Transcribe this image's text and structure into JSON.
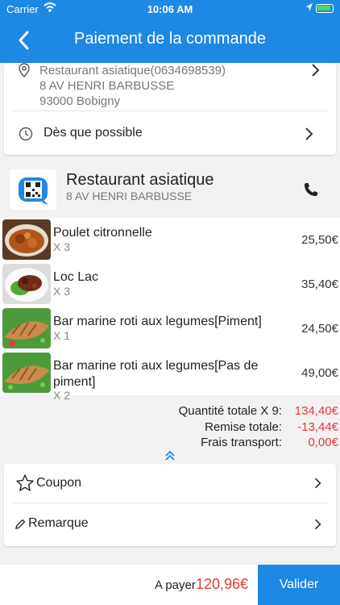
{
  "status_bar": {
    "carrier": "Carrier",
    "time": "10:06 AM"
  },
  "header": {
    "title": "Paiement de la commande"
  },
  "delivery": {
    "address_line1": "Restaurant asiatique(0634698539)",
    "address_line2": "8 AV HENRI BARBUSSE",
    "address_line3": "93000 Bobigny",
    "time_label": "Dès que possible"
  },
  "restaurant": {
    "name": "Restaurant asiatique",
    "address": "8 AV HENRI BARBUSSE"
  },
  "items": [
    {
      "name": "Poulet citronnelle",
      "qty": "X 3",
      "price": "25,50€"
    },
    {
      "name": "Loc Lac",
      "qty": "X 3",
      "price": "35,40€"
    },
    {
      "name": "Bar marine roti aux legumes[Piment]",
      "qty": "X 1",
      "price": "24,50€"
    },
    {
      "name": "Bar marine roti aux legumes[Pas de piment]",
      "qty": "X 2",
      "price": "49,00€"
    }
  ],
  "totals": {
    "quantity_label": "Quantité totale X 9:",
    "quantity_value": "134,40€",
    "discount_label": "Remise totale:",
    "discount_value": "-13,44€",
    "transport_label": "Frais transport:",
    "transport_value": "0,00€"
  },
  "options": {
    "coupon_label": "Coupon",
    "remark_label": "Remarque"
  },
  "footer": {
    "pay_label": "A payer",
    "pay_amount": "120,96€",
    "validate_label": "Valider"
  },
  "colors": {
    "primary": "#1e88e5",
    "accent_red": "#e53935"
  }
}
